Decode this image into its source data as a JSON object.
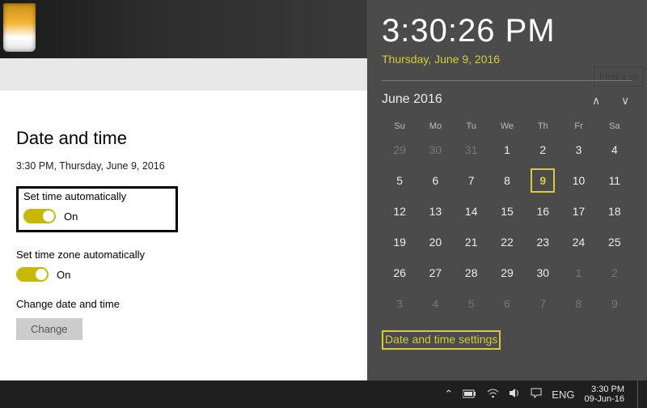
{
  "header": {
    "search_placeholder": "Find a se"
  },
  "settings": {
    "title": "Date and time",
    "current": "3:30 PM, Thursday, June 9, 2016",
    "set_time_auto_label": "Set time automatically",
    "set_time_auto_state": "On",
    "set_zone_auto_label": "Set time zone automatically",
    "set_zone_auto_state": "On",
    "change_label": "Change date and time",
    "change_button": "Change"
  },
  "flyout": {
    "time": "3:30:26 PM",
    "date": "Thursday, June 9, 2016",
    "month_label": "June 2016",
    "dow": [
      "Su",
      "Mo",
      "Tu",
      "We",
      "Th",
      "Fr",
      "Sa"
    ],
    "grid": [
      [
        "29",
        "30",
        "31",
        "1",
        "2",
        "3",
        "4"
      ],
      [
        "5",
        "6",
        "7",
        "8",
        "9",
        "10",
        "11"
      ],
      [
        "12",
        "13",
        "14",
        "15",
        "16",
        "17",
        "18"
      ],
      [
        "19",
        "20",
        "21",
        "22",
        "23",
        "24",
        "25"
      ],
      [
        "26",
        "27",
        "28",
        "29",
        "30",
        "1",
        "2"
      ],
      [
        "3",
        "4",
        "5",
        "6",
        "7",
        "8",
        "9"
      ]
    ],
    "today_index": [
      1,
      4
    ],
    "link": "Date and time settings"
  },
  "taskbar": {
    "lang": "ENG",
    "time": "3:30 PM",
    "date": "09-Jun-16"
  }
}
